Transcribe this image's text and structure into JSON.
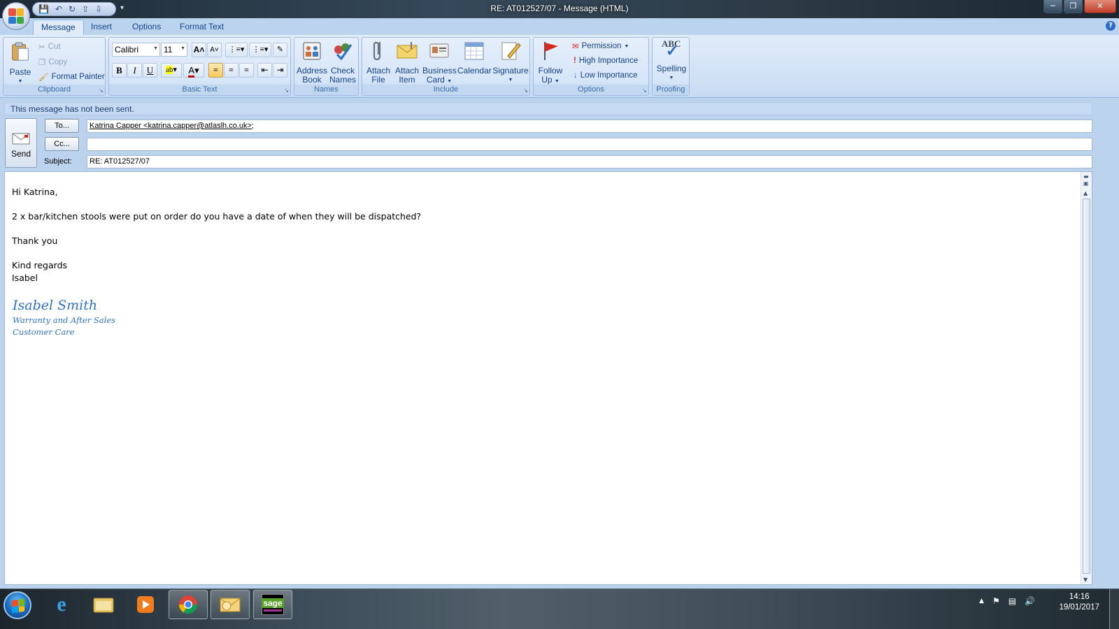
{
  "window": {
    "title": "RE: AT012527/07 - Message (HTML)",
    "minimize": "─",
    "maximize": "❐",
    "close": "✕"
  },
  "tabs": [
    "Message",
    "Insert",
    "Options",
    "Format Text"
  ],
  "help": "?",
  "ribbon": {
    "clipboard": {
      "label": "Clipboard",
      "paste": "Paste",
      "cut": "Cut",
      "copy": "Copy",
      "format_painter": "Format Painter"
    },
    "basic_text": {
      "label": "Basic Text",
      "font": "Calibri",
      "size": "11"
    },
    "names": {
      "label": "Names",
      "address_book_1": "Address",
      "address_book_2": "Book",
      "check_names_1": "Check",
      "check_names_2": "Names"
    },
    "include": {
      "label": "Include",
      "attach_file_1": "Attach",
      "attach_file_2": "File",
      "attach_item_1": "Attach",
      "attach_item_2": "Item",
      "business_card_1": "Business",
      "business_card_2": "Card",
      "calendar": "Calendar",
      "signature": "Signature"
    },
    "options": {
      "label": "Options",
      "follow_up_1": "Follow",
      "follow_up_2": "Up",
      "permission": "Permission",
      "high_importance": "High Importance",
      "low_importance": "Low Importance"
    },
    "proofing": {
      "label": "Proofing",
      "spelling": "Spelling",
      "abc": "ABC"
    }
  },
  "message": {
    "info": "This message has not been sent.",
    "send": "Send",
    "to_button": "To...",
    "cc_button": "Cc...",
    "subject_label": "Subject:",
    "to_recipient": "Katrina Capper <katrina.capper@atlaslh.co.uk>",
    "to_separator": ";",
    "cc_value": "",
    "subject_value": "RE: AT012527/07"
  },
  "body": {
    "greeting": "Hi Katrina,",
    "line1": "2 x bar/kitchen stools were put on order do you have a date of when they will be dispatched?",
    "thanks": "Thank you",
    "closing": "Kind regards",
    "first_name": "Isabel",
    "sig_name": "Isabel Smith",
    "sig_dept": "Warranty and After Sales",
    "sig_team": "Customer Care"
  },
  "taskbar": {
    "time": "14:16",
    "date": "19/01/2017",
    "sage_label": "sage"
  },
  "colors": {
    "ribbon_text": "#15428b",
    "signature": "#2d72c6",
    "office_logo": [
      "#e8533f",
      "#f5b326",
      "#2c7ad6",
      "#41a847"
    ]
  }
}
